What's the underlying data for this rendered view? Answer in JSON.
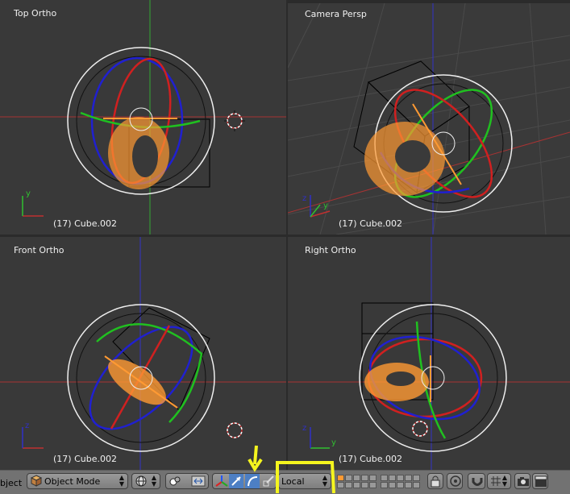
{
  "viewports": {
    "top_left": {
      "title": "Top Ortho",
      "object_label": "(17) Cube.002"
    },
    "top_right": {
      "title": "Camera Persp",
      "object_label": "(17) Cube.002"
    },
    "bottom_left": {
      "title": "Front Ortho",
      "object_label": "(17) Cube.002"
    },
    "bottom_right": {
      "title": "Right Ortho",
      "object_label": "(17) Cube.002"
    }
  },
  "axis_labels": {
    "x": "x",
    "y": "y",
    "z": "z"
  },
  "header": {
    "menu_cut_label": "bject",
    "mode_select": {
      "value": "Object Mode"
    },
    "orientation_select": {
      "value": "Local"
    },
    "icons": {
      "mode_icon": "cube-icon",
      "viewport_shading": "globe-icon",
      "pivot": "pivot-icon",
      "manipulator_toggle": "manipulator-icon",
      "translate": "translate-icon",
      "rotate": "rotate-icon",
      "scale": "scale-icon",
      "lock_icon": "lock-icon",
      "snap": "magnet-icon",
      "render": "camera-icon",
      "anim_render": "clapper-icon"
    }
  },
  "colors": {
    "viewport_bg": "#393939",
    "grid_x_axis": "#a83333",
    "grid_y_axis": "#33a833",
    "grid_z_axis": "#3333c8",
    "torus": "#ff9a33",
    "annotation_yellow": "#f5f51e"
  }
}
